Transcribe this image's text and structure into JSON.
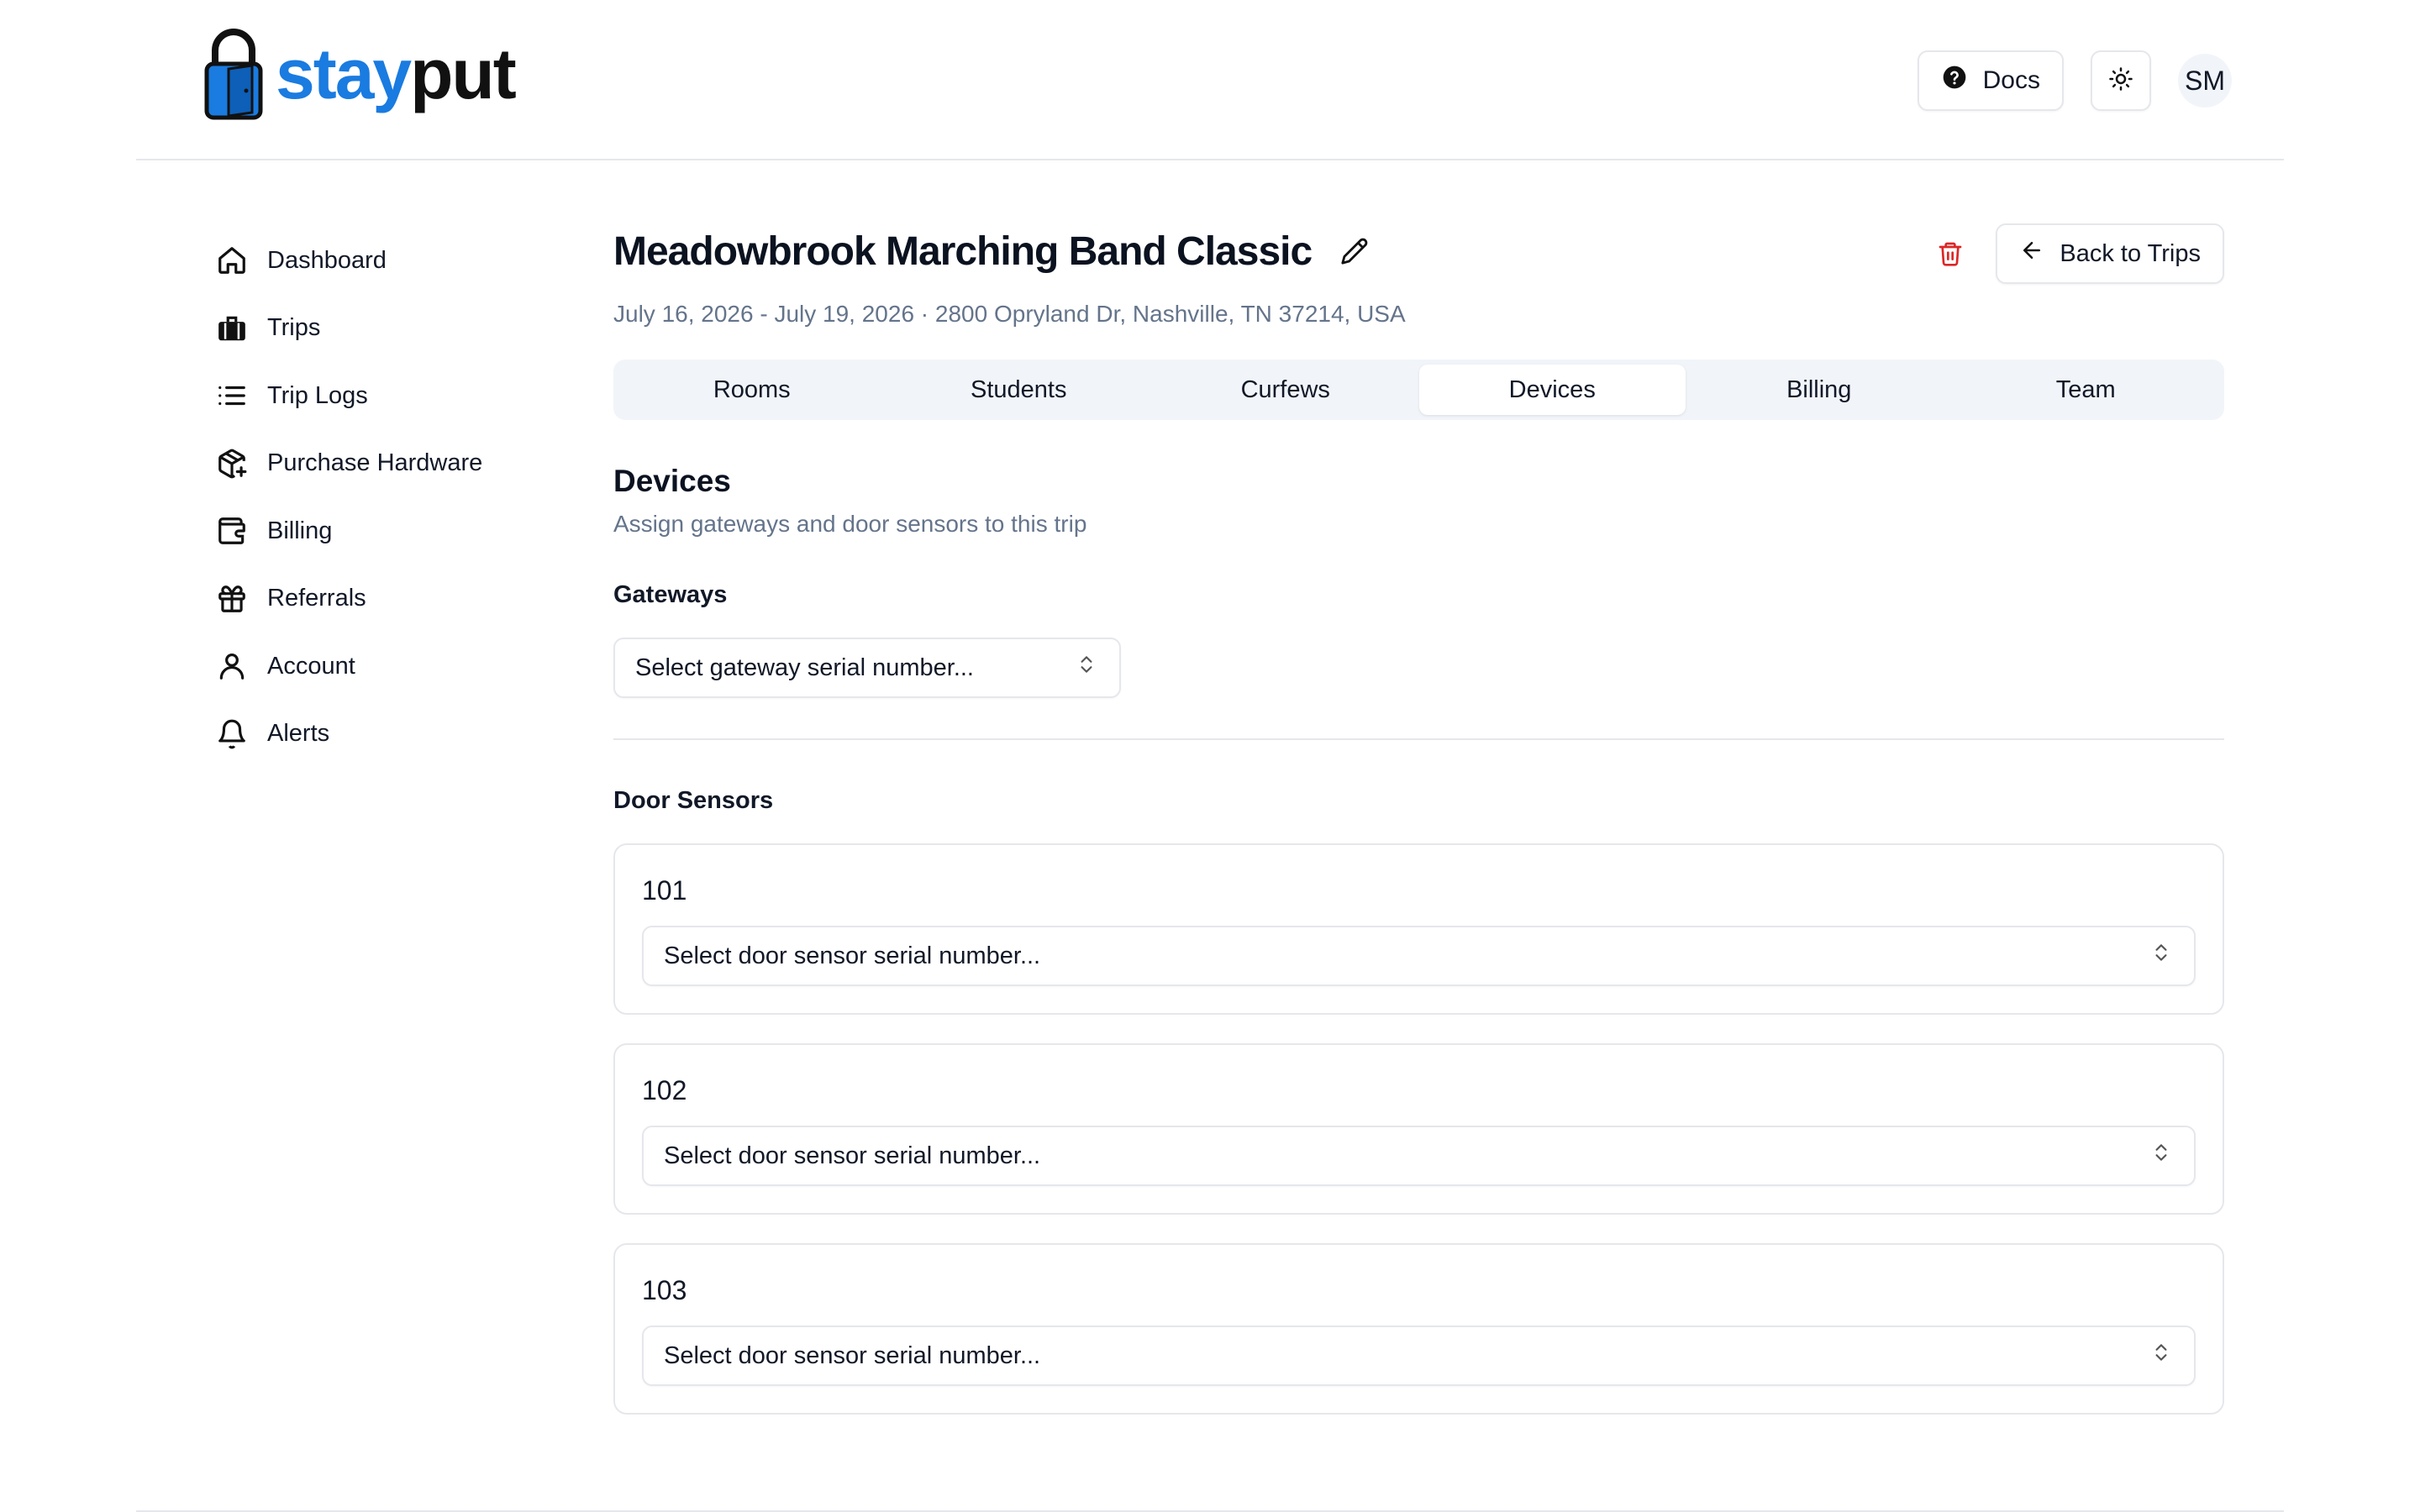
{
  "brand": {
    "name_part1": "stay",
    "name_part2": "put"
  },
  "header": {
    "docs_label": "Docs",
    "avatar_initials": "SM"
  },
  "sidebar": {
    "items": [
      {
        "label": "Dashboard",
        "icon": "home-icon"
      },
      {
        "label": "Trips",
        "icon": "luggage-icon"
      },
      {
        "label": "Trip Logs",
        "icon": "list-icon"
      },
      {
        "label": "Purchase Hardware",
        "icon": "package-plus-icon"
      },
      {
        "label": "Billing",
        "icon": "wallet-icon"
      },
      {
        "label": "Referrals",
        "icon": "gift-icon"
      },
      {
        "label": "Account",
        "icon": "user-icon"
      },
      {
        "label": "Alerts",
        "icon": "bell-icon"
      }
    ]
  },
  "trip": {
    "title": "Meadowbrook Marching Band Classic",
    "subtitle": "July 16, 2026 - July 19, 2026 · 2800 Opryland Dr, Nashville, TN 37214, USA",
    "back_label": "Back to Trips"
  },
  "tabs": [
    {
      "label": "Rooms",
      "active": false
    },
    {
      "label": "Students",
      "active": false
    },
    {
      "label": "Curfews",
      "active": false
    },
    {
      "label": "Devices",
      "active": true
    },
    {
      "label": "Billing",
      "active": false
    },
    {
      "label": "Team",
      "active": false
    }
  ],
  "devices": {
    "title": "Devices",
    "description": "Assign gateways and door sensors to this trip",
    "gateways_label": "Gateways",
    "gateway_placeholder": "Select gateway serial number...",
    "door_sensors_label": "Door Sensors",
    "sensors": [
      {
        "room": "101",
        "placeholder": "Select door sensor serial number..."
      },
      {
        "room": "102",
        "placeholder": "Select door sensor serial number..."
      },
      {
        "room": "103",
        "placeholder": "Select door sensor serial number..."
      }
    ]
  },
  "colors": {
    "brand_blue": "#1a7be0",
    "danger": "#dc2626",
    "muted": "#64748b",
    "tab_bg": "#f1f5f9"
  }
}
